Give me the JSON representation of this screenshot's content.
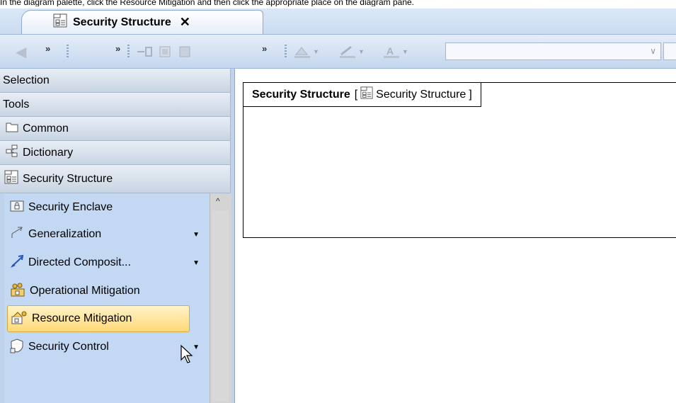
{
  "instruction": "In the diagram palette, click the Resource Mitigation and then click the appropriate place on the diagram pane.",
  "tab": {
    "title": "Security Structure",
    "close": "✕"
  },
  "toolbar": {
    "back": "◆",
    "overflow1": "»",
    "overflow2": "»",
    "overflow3": "»",
    "combo_value": "",
    "combo_arrow": "∨"
  },
  "palette": {
    "categories": [
      {
        "label": "Selection"
      },
      {
        "label": "Tools"
      },
      {
        "label": "Common",
        "icon": "folder-icon"
      },
      {
        "label": "Dictionary",
        "icon": "dictionary-icon"
      },
      {
        "label": "Security Structure",
        "icon": "diagram-icon"
      }
    ],
    "items": [
      {
        "label": "Security Enclave",
        "icon": "enclave-icon"
      },
      {
        "label": "Generalization",
        "icon": "generalization-icon",
        "dropdown": "▼"
      },
      {
        "label": "Directed Composit...",
        "icon": "directed-composition-icon",
        "dropdown": "▼"
      },
      {
        "label": "Operational Mitigation",
        "icon": "operational-mitigation-icon"
      },
      {
        "label": "Resource Mitigation",
        "icon": "resource-mitigation-icon",
        "selected": true
      },
      {
        "label": "Security Control",
        "icon": "security-control-icon",
        "dropdown": "▼"
      }
    ],
    "scroll_up": "^"
  },
  "diagram": {
    "frame_name": "Security Structure",
    "frame_open": "[",
    "frame_type": "Security Structure",
    "frame_close": "]"
  },
  "colors": {
    "selected_bg": "#ffd978",
    "palette_bg": "#c3d8f3",
    "header_bg": "#d9e6f5"
  }
}
